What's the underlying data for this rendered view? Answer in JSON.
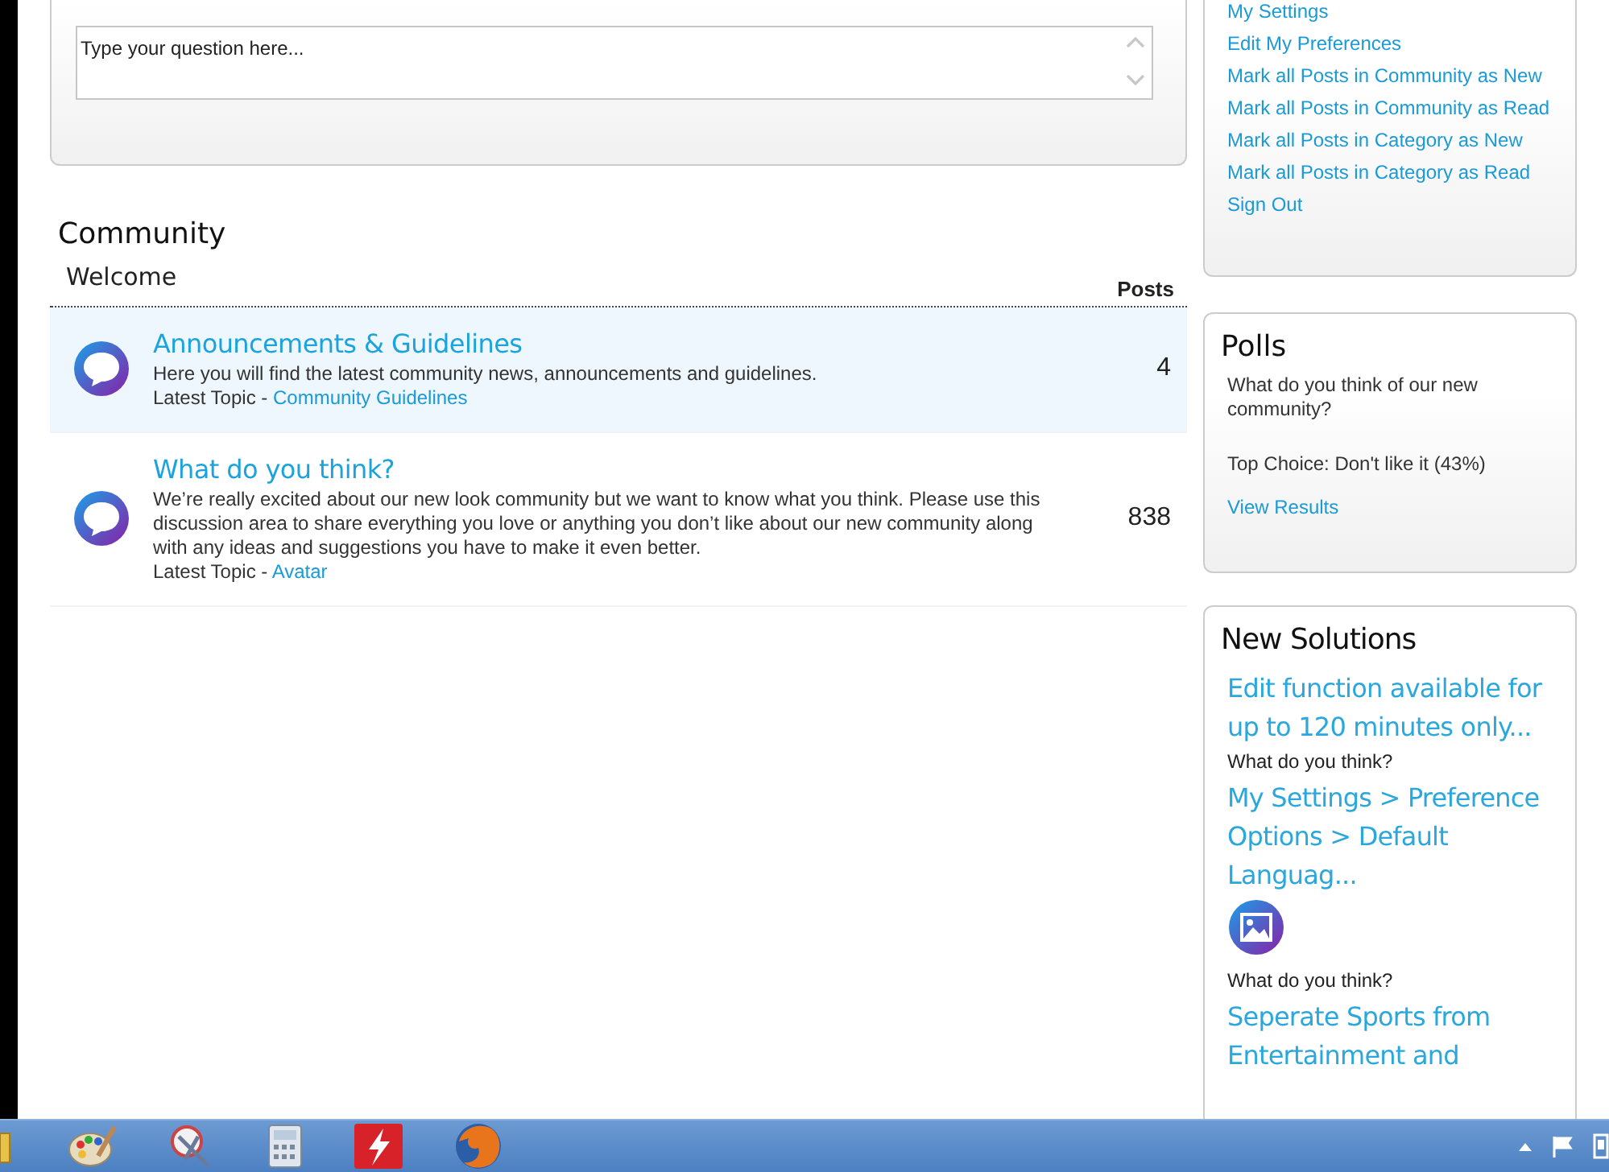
{
  "question_box": {
    "placeholder": "Type your question here..."
  },
  "community": {
    "title": "Community",
    "section": "Welcome",
    "posts_header": "Posts",
    "boards": [
      {
        "title": "Announcements & Guidelines",
        "description": "Here you will find the latest community news, announcements and guidelines.",
        "latest_label": "Latest Topic -",
        "latest_link": "Community Guidelines",
        "posts": "4",
        "selected": true
      },
      {
        "title": "What do you think?",
        "description": "We’re really excited about our new look community but we want to know what you think. Please use this discussion area to share everything you love or anything you don’t like about our new community along with any ideas and suggestions you have to make it even better.",
        "latest_label": "Latest Topic -",
        "latest_link": "Avatar",
        "posts": "838",
        "selected": false
      }
    ]
  },
  "user_menu": {
    "links": [
      "My Settings",
      "Edit My Preferences",
      "Mark all Posts in Community as New",
      "Mark all Posts in Community as Read",
      "Mark all Posts in Category as New",
      "Mark all Posts in Category as Read",
      "Sign Out"
    ]
  },
  "polls": {
    "title": "Polls",
    "question": "What do you think of our new community?",
    "top_choice": "Top Choice: Don't like it (43%)",
    "link": "View Results"
  },
  "new_solutions": {
    "title": "New Solutions",
    "items": [
      {
        "title": "Edit function available for up to 120 minutes only...",
        "has_image": false,
        "board": "What do you think?"
      },
      {
        "title": "My Settings > Preference Options > Default Languag...",
        "has_image": true,
        "board": "What do you think?"
      },
      {
        "title": "Seperate Sports from Entertainment and",
        "has_image": false
      }
    ]
  }
}
